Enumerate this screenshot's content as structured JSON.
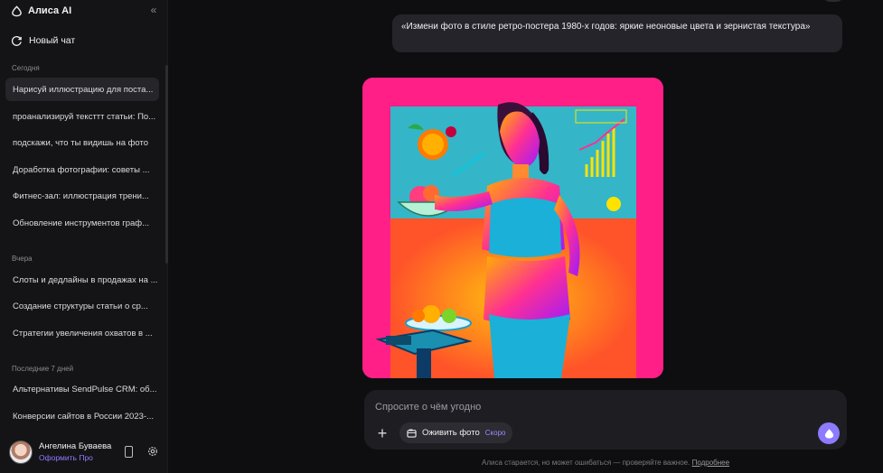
{
  "sidebar": {
    "brand": "Алиса AI",
    "new_chat": "Новый чат",
    "sections": [
      {
        "title": "Сегодня",
        "items": [
          "Нарисуй иллюстрацию для поста...",
          "проанализируй тексттт статьи: По...",
          "подскажи, что ты видишь на фото",
          "Доработка фотографии: советы ...",
          "Фитнес-зал: иллюстрация трени...",
          "Обновление инструментов граф..."
        ]
      },
      {
        "title": "Вчера",
        "items": [
          "Слоты и дедлайны в продажах на ...",
          "Создание структуры статьи о ср...",
          "Стратегии увеличения охватов в ..."
        ]
      },
      {
        "title": "Последние 7 дней",
        "items": [
          "Альтернативы SendPulse CRM: об...",
          "Конверсии сайтов в России 2023-..."
        ]
      }
    ],
    "user": {
      "name": "Ангелина Буваева",
      "subscription": "Оформить Про"
    }
  },
  "chat": {
    "user_message": "«Измени фото в стиле ретро-постера 1980-х годов: яркие неоновые цвета и зернистая текстура»"
  },
  "composer": {
    "placeholder": "Спросите о чём угодно",
    "revive_label": "Оживить фото",
    "soon_badge": "Скоро"
  },
  "footer": {
    "disclaimer": "Алиса старается, но может ошибаться — проверяйте важное.",
    "details_link": "Подробнее"
  },
  "colors": {
    "accent": "#8c7bff",
    "image_bg": "#ff1f86"
  }
}
